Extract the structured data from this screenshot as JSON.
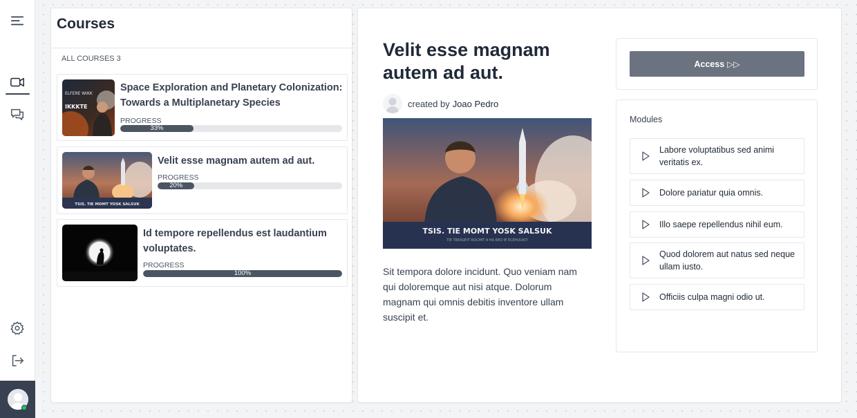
{
  "nav": {
    "icons": [
      "menu-icon",
      "video-icon",
      "chat-icon",
      "gear-icon",
      "logout-icon",
      "user-avatar"
    ]
  },
  "courses_panel": {
    "title": "Courses",
    "all_courses_label": "ALL COURSES 3",
    "progress_label": "PROGRESS",
    "items": [
      {
        "title": "Space Exploration and Planetary Colonization: Towards a Multiplanetary Species",
        "progress": 33,
        "progress_text": "33%",
        "thumb_text": [
          "ELFERE  WIKK",
          "IKKKTE"
        ]
      },
      {
        "title": "Velit esse magnam autem ad aut.",
        "progress": 20,
        "progress_text": "20%",
        "thumb_text": [
          "TSIS. TIE MOMT YOSK SALSUK"
        ]
      },
      {
        "title": "Id tempore repellendus est laudantium voluptates.",
        "progress": 100,
        "progress_text": "100%",
        "thumb_text": []
      }
    ]
  },
  "detail": {
    "title": "Velit esse magnam autem ad aut.",
    "created_by_label": "created by",
    "author": "Joao Pedro",
    "hero_caption": "TSIS. TIE MOMT YOSK SALSUK",
    "hero_subcaption": "TIE TREAUEIT ROCMIT A HA REO IE ECEHUUKIT",
    "description": "Sit tempora dolore incidunt. Quo veniam nam qui doloremque aut nisi atque. Dolorum magnam qui omnis debitis inventore ullam suscipit et.",
    "access_label": "Access",
    "access_icon": "fast-forward-icon",
    "modules_heading": "Modules",
    "modules": [
      "Labore voluptatibus sed animi veritatis ex.",
      "Dolore pariatur quia omnis.",
      "Illo saepe repellendus nihil eum.",
      "Quod dolorem aut natus sed neque ullam iusto.",
      "Officiis culpa magni odio ut."
    ]
  },
  "colors": {
    "accent": "#4b5563",
    "button": "#6b7280",
    "online": "#22c55e",
    "rail_bottom": "#374151"
  }
}
